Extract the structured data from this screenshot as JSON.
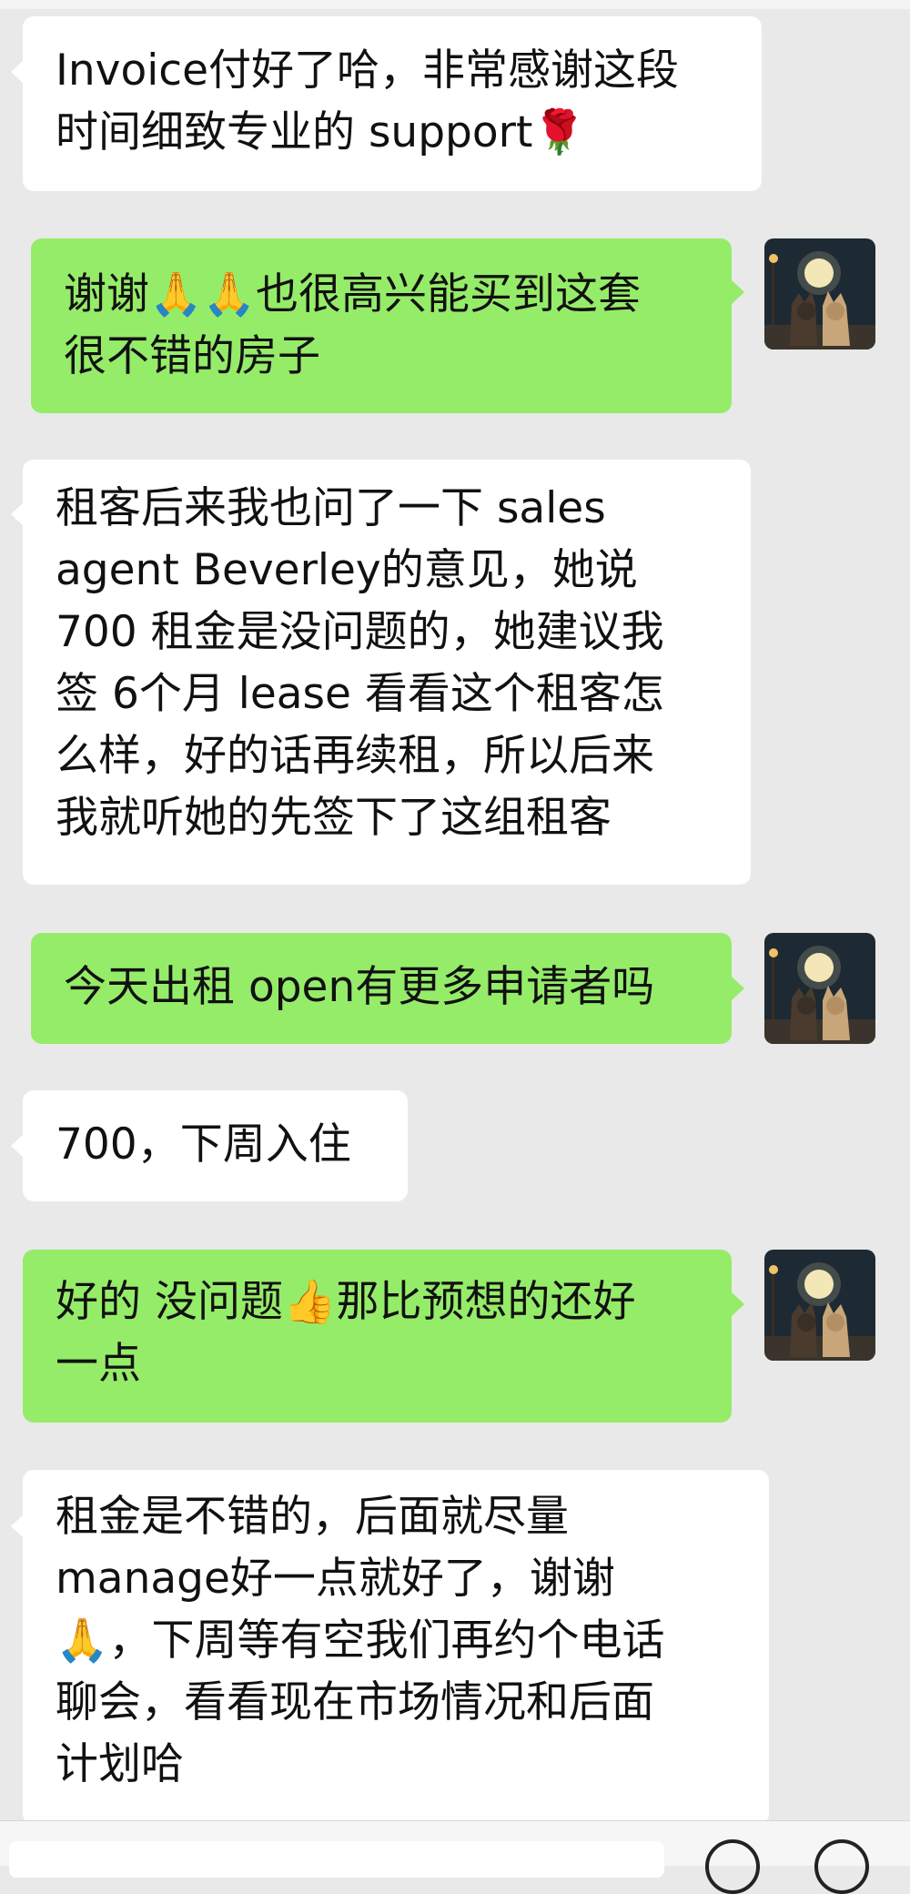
{
  "conversation": {
    "messages": [
      {
        "sender": "contact",
        "text": "Invoice付好了哈，非常感谢这段\n时间细致专业的 support🌹"
      },
      {
        "sender": "me",
        "text": "谢谢🙏🙏也很高兴能买到这套\n很不错的房子"
      },
      {
        "sender": "contact",
        "text": "租客后来我也问了一下 sales\nagent Beverley的意见，她说\n700 租金是没问题的，她建议我\n签 6个月 lease 看看这个租客怎\n么样，好的话再续租，所以后来\n我就听她的先签下了这组租客"
      },
      {
        "sender": "me",
        "text": "今天出租 open有更多申请者吗"
      },
      {
        "sender": "contact",
        "text": "700，下周入住"
      },
      {
        "sender": "me",
        "text": "好的 没问题👍那比预想的还好\n一点"
      },
      {
        "sender": "contact",
        "text": "租金是不错的，后面就尽量\nmanage好一点就好了，谢谢\n🙏，下周等有空我们再约个电话\n聊会，看看现在市场情况和后面\n计划哈"
      }
    ]
  },
  "avatar": {
    "icon": "cats-moon-avatar-icon"
  },
  "colors": {
    "incoming": "#ffffff",
    "outgoing": "#95ec69",
    "background": "#e9e9e9"
  }
}
